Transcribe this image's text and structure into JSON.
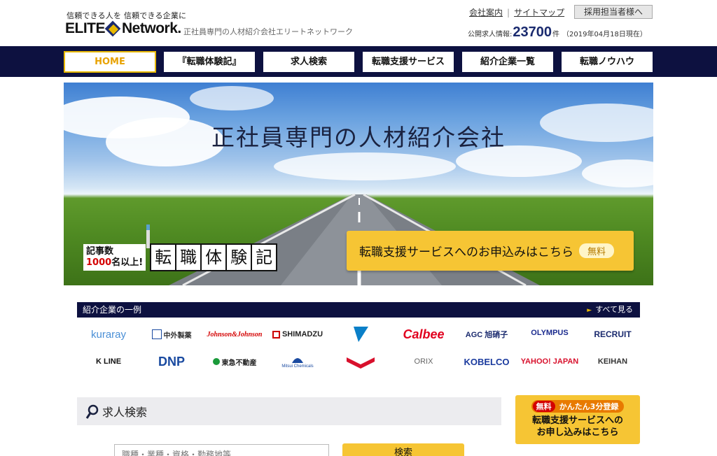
{
  "header": {
    "tagline": "信頼できる人を 信頼できる企業に",
    "logo_left": "ELITE",
    "logo_right": "Network.",
    "subtitle": "正社員専門の人材紹介会社エリートネットワーク",
    "links": [
      "会社案内",
      "サイトマップ"
    ],
    "recruiter_button": "採用担当者様へ",
    "stats_label": "公開求人情報:",
    "stats_count": "23700",
    "stats_unit": "件",
    "stats_date": "（2019年04月18日現在）"
  },
  "nav": {
    "items": [
      "HOME",
      "『転職体験記』",
      "求人検索",
      "転職支援サービス",
      "紹介企業一覧",
      "転職ノウハウ"
    ],
    "active_index": 0
  },
  "hero": {
    "title": "正社員専門の人材紹介会社",
    "badge_line1": "記事数",
    "badge_num": "1000",
    "badge_line2": "名以上!",
    "badge_chars": [
      "転",
      "職",
      "体",
      "験",
      "記"
    ],
    "service_button": "転職支援サービスへのお申込みはこちら",
    "free_label": "無料"
  },
  "companies": {
    "heading": "紹介企業の一例",
    "more": "すべて見る",
    "row1": [
      "kuraray",
      "中外製薬",
      "Johnson&Johnson",
      "SHIMADZU",
      "DAIKIN",
      "Calbee",
      "AGC 旭硝子",
      "OLYMPUS",
      "RECRUIT"
    ],
    "row2": [
      "K LINE",
      "DNP",
      "東急不動産",
      "Mitsui Chemicals",
      "MITSUBISHI",
      "ORIX",
      "KOBELCO",
      "YAHOO! JAPAN",
      "KEIHAN"
    ]
  },
  "search": {
    "heading": "求人検索",
    "placeholder": "職種・業種・資格・勤務地等",
    "button": "検索"
  },
  "side_cta": {
    "free": "無料",
    "top_text": "かんたん3分登録",
    "line1": "転職支援サービスへの",
    "line2": "お申し込みはこちら"
  },
  "colors": {
    "navy": "#0d1140",
    "accent_yellow": "#f6c534",
    "active_orange": "#e8a200"
  }
}
